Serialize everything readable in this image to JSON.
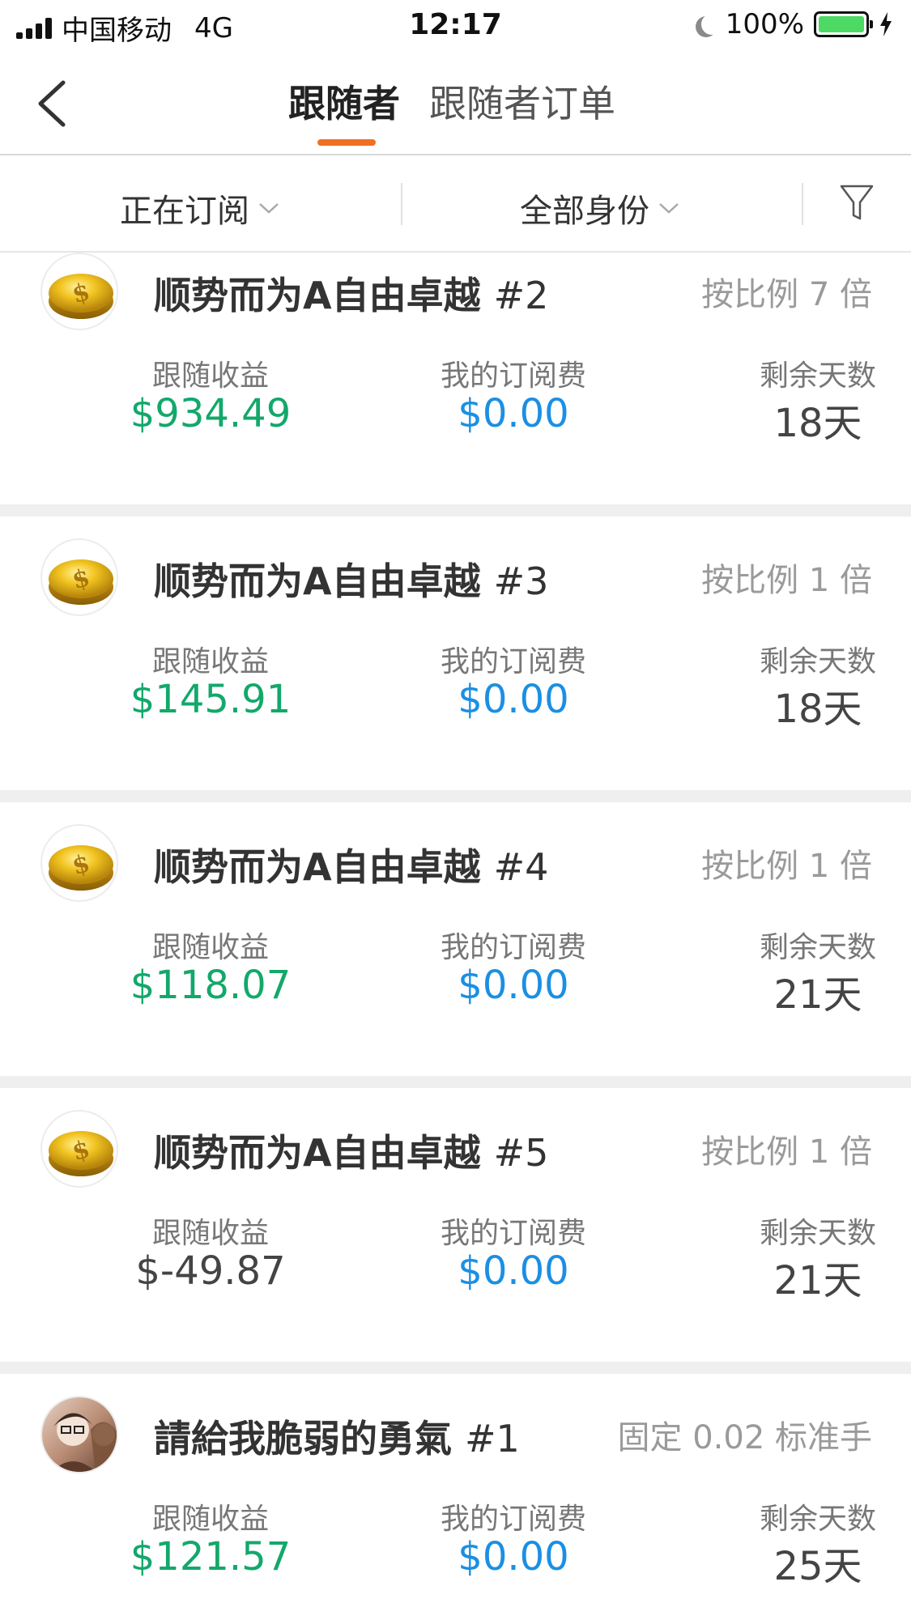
{
  "status_bar": {
    "carrier": "中国移动",
    "network": "4G",
    "time": "12:17",
    "battery": "100%",
    "battery_color": "#4cd964"
  },
  "nav": {
    "tabs": [
      {
        "label": "跟随者",
        "active": true
      },
      {
        "label": "跟随者订单",
        "active": false
      }
    ],
    "accent_color": "#f07023"
  },
  "filters": {
    "subscription": "正在订阅",
    "identity": "全部身份"
  },
  "column_labels": {
    "profit": "跟随收益",
    "fee": "我的订阅费",
    "days": "剩余天数"
  },
  "followers": [
    {
      "name": "顺势而为A自由卓越",
      "number": "#2",
      "ratio": "按比例 7 倍",
      "profit": "$934.49",
      "profit_color": "green",
      "fee": "$0.00",
      "days": "18天",
      "avatar": "gold-coin"
    },
    {
      "name": "顺势而为A自由卓越",
      "number": "#3",
      "ratio": "按比例 1 倍",
      "profit": "$145.91",
      "profit_color": "green",
      "fee": "$0.00",
      "days": "18天",
      "avatar": "gold-coin"
    },
    {
      "name": "顺势而为A自由卓越",
      "number": "#4",
      "ratio": "按比例 1 倍",
      "profit": "$118.07",
      "profit_color": "green",
      "fee": "$0.00",
      "days": "21天",
      "avatar": "gold-coin"
    },
    {
      "name": "顺势而为A自由卓越",
      "number": "#5",
      "ratio": "按比例 1 倍",
      "profit": "$-49.87",
      "profit_color": "dark",
      "fee": "$0.00",
      "days": "21天",
      "avatar": "gold-coin"
    },
    {
      "name": "請給我脆弱的勇氣",
      "number": "#1",
      "ratio": "固定 0.02 标准手",
      "profit": "$121.57",
      "profit_color": "green",
      "fee": "$0.00",
      "days": "25天",
      "avatar": "photo"
    }
  ],
  "colors": {
    "profit_positive": "#13a86b",
    "fee": "#1b8fe3",
    "profit_negative": "#444444"
  }
}
